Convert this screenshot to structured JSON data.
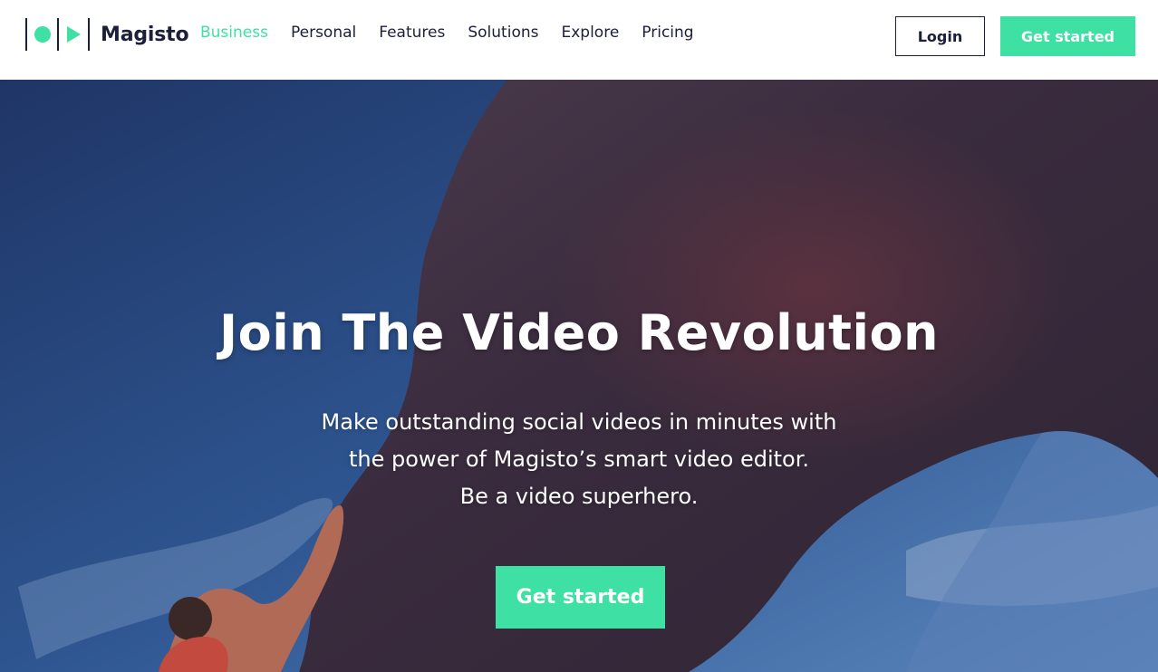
{
  "brand": {
    "name": "Magisto",
    "accent_color": "#3ee0a3",
    "text_color": "#1b1f3b"
  },
  "nav": {
    "items": [
      {
        "label": "Business",
        "active": true
      },
      {
        "label": "Personal",
        "active": false
      },
      {
        "label": "Features",
        "active": false
      },
      {
        "label": "Solutions",
        "active": false
      },
      {
        "label": "Explore",
        "active": false
      },
      {
        "label": "Pricing",
        "active": false
      }
    ]
  },
  "header": {
    "login_label": "Login",
    "cta_label": "Get started"
  },
  "hero": {
    "title": "Join The Video Revolution",
    "subtitle_lines": [
      "Make outstanding social videos in minutes with",
      "the power of Magisto’s smart video editor.",
      "Be a video superhero."
    ],
    "cta_label": "Get started"
  }
}
